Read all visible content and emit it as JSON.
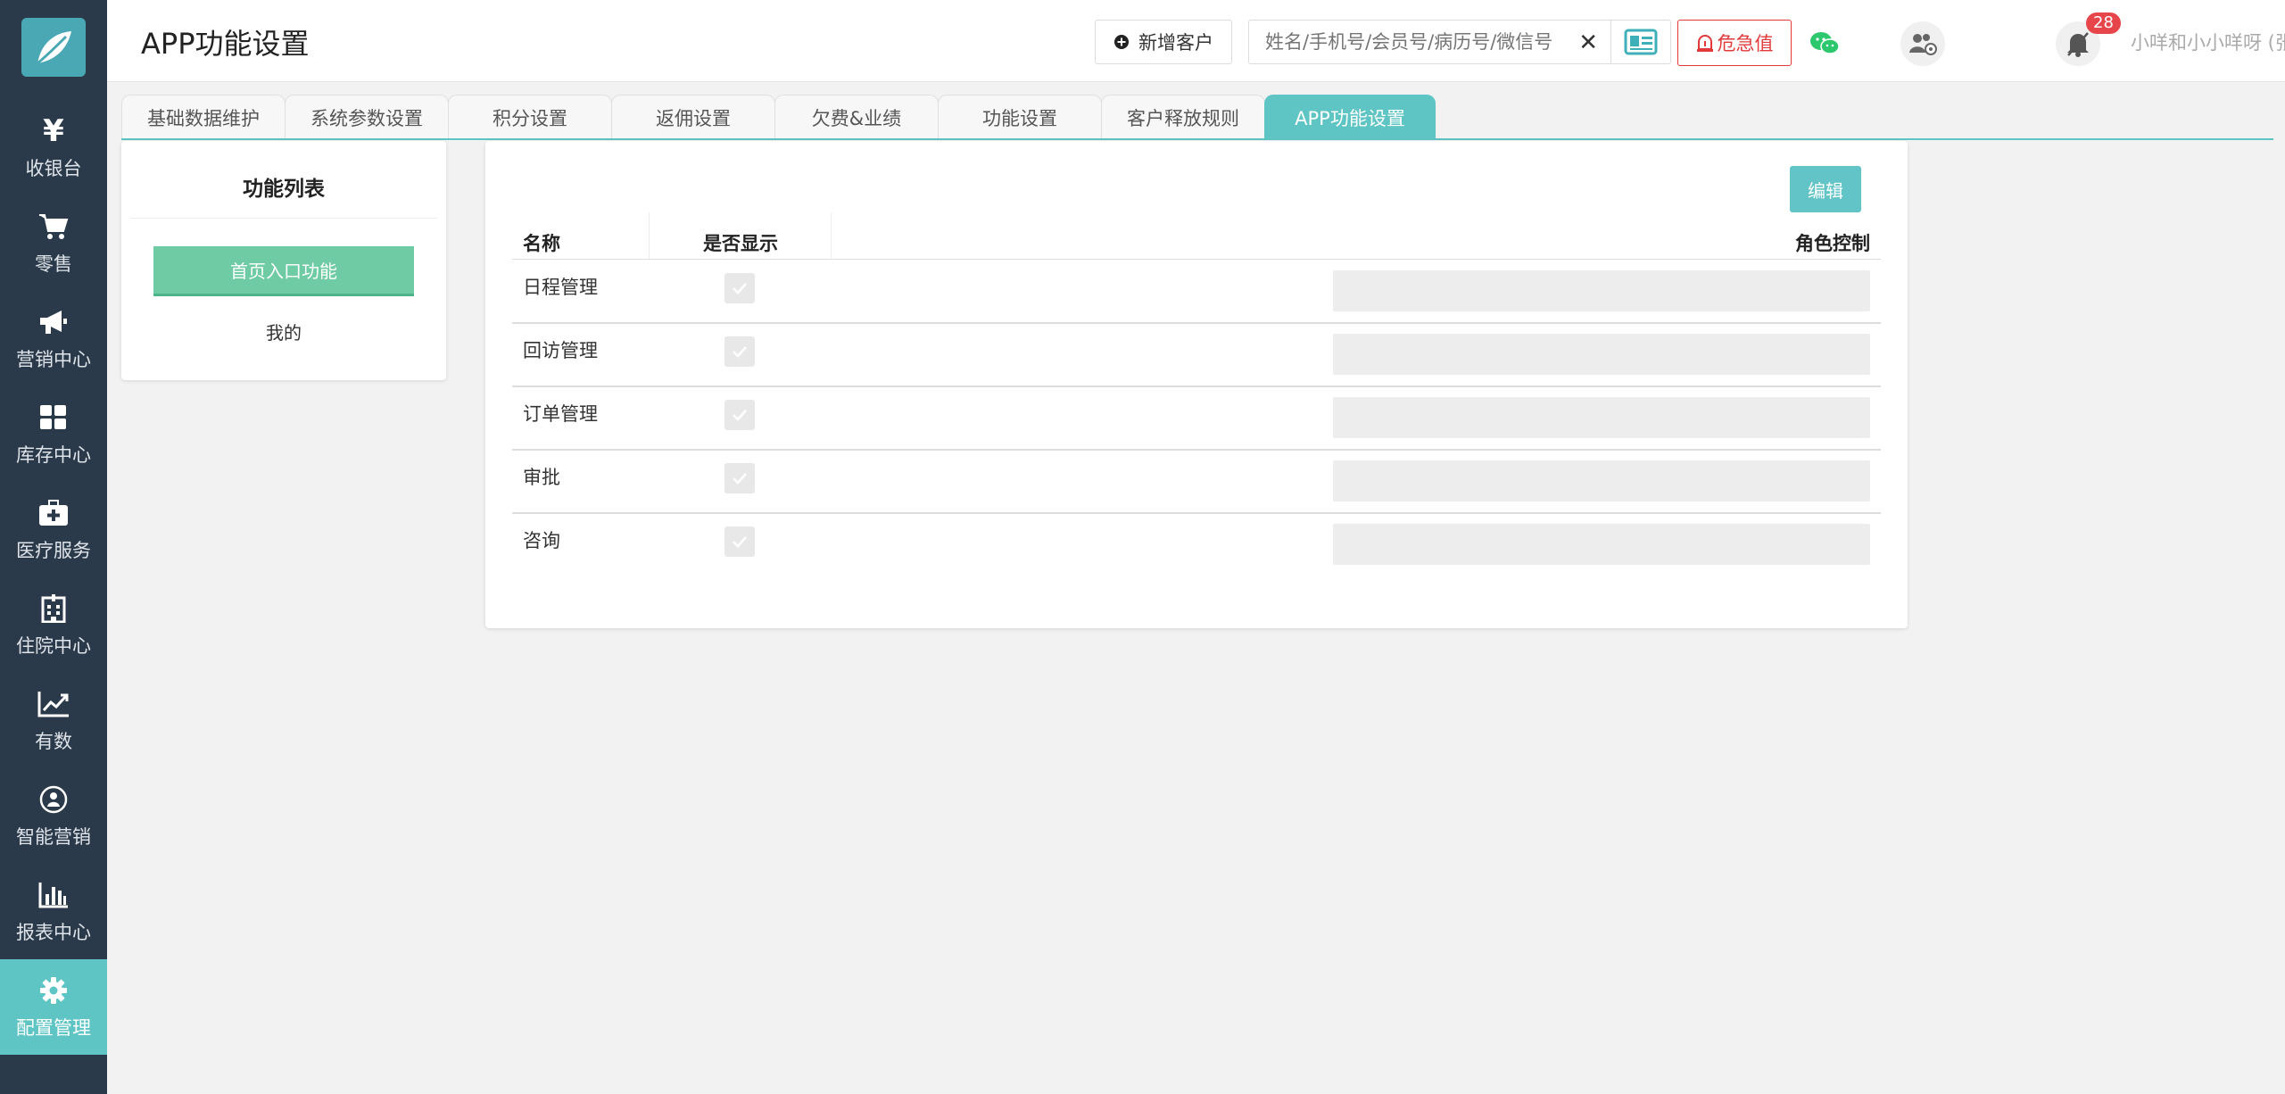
{
  "header": {
    "title": "APP功能设置",
    "new_customer": "新增客户",
    "search_placeholder": "姓名/手机号/会员号/病历号/微信号",
    "clear_symbol": "✕",
    "danger_button": "危急值",
    "notification_count": "28",
    "user": "小咩和小小咩呀 (张江门诊部)"
  },
  "sidebar": {
    "items": [
      {
        "label": "收银台",
        "icon": "yen-icon"
      },
      {
        "label": "零售",
        "icon": "cart-icon"
      },
      {
        "label": "营销中心",
        "icon": "megaphone-icon"
      },
      {
        "label": "库存中心",
        "icon": "grid-icon"
      },
      {
        "label": "医疗服务",
        "icon": "medkit-icon"
      },
      {
        "label": "住院中心",
        "icon": "hospital-icon"
      },
      {
        "label": "有数",
        "icon": "line-chart-icon"
      },
      {
        "label": "智能营销",
        "icon": "group-icon"
      },
      {
        "label": "报表中心",
        "icon": "bar-chart-icon"
      },
      {
        "label": "配置管理",
        "icon": "gear-icon"
      }
    ]
  },
  "tabs": [
    {
      "label": "基础数据维护"
    },
    {
      "label": "系统参数设置"
    },
    {
      "label": "积分设置"
    },
    {
      "label": "返佣设置"
    },
    {
      "label": "欠费&业绩"
    },
    {
      "label": "功能设置"
    },
    {
      "label": "客户释放规则"
    },
    {
      "label": "APP功能设置"
    }
  ],
  "left_panel": {
    "title": "功能列表",
    "items": [
      "首页入口功能",
      "我的"
    ]
  },
  "main": {
    "edit_button": "编辑",
    "columns": [
      "名称",
      "是否显示",
      "角色控制"
    ],
    "rows": [
      {
        "name": "日程管理",
        "shown": true
      },
      {
        "name": "回访管理",
        "shown": true
      },
      {
        "name": "订单管理",
        "shown": true
      },
      {
        "name": "审批",
        "shown": true
      },
      {
        "name": "咨询",
        "shown": true
      }
    ]
  },
  "colors": {
    "sidebar_bg": "#2b3a4a",
    "accent": "#5ec4c4",
    "active_item": "#6ecba4",
    "danger": "#e23a3a"
  }
}
